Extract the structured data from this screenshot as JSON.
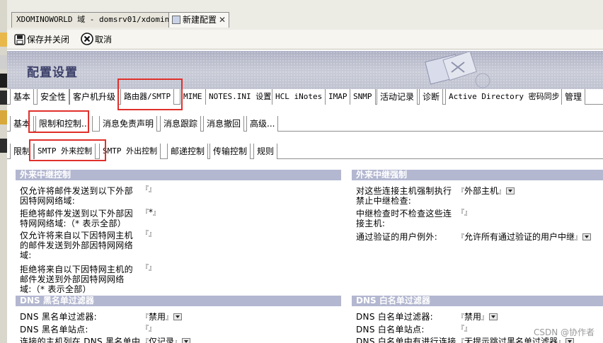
{
  "window_tabs": [
    {
      "label": "XDOMINOWORLD 域 - domsrv01/xdomino"
    },
    {
      "label": "新建配置"
    }
  ],
  "toolbar": {
    "save_close": "保存并关闭",
    "cancel": "取消"
  },
  "banner": {
    "title": "配置设置"
  },
  "main_tabs": [
    "基本",
    "安全性",
    "客户机升级",
    "路由器/SMTP",
    "MIME",
    "NOTES.INI 设置",
    "HCL iNotes",
    "IMAP",
    "SNMP",
    "活动记录",
    "诊断",
    "Active Directory 密码同步",
    "管理"
  ],
  "sub_tabs": [
    "基本",
    "限制和控制...",
    "消息免责声明",
    "消息跟踪",
    "消息撤回",
    "高级..."
  ],
  "sub_sub_tabs": [
    "限制",
    "SMTP 外来控制",
    "SMTP 外出控制",
    "邮递控制",
    "传输控制",
    "规则"
  ],
  "left_section": {
    "header": "外来中继控制",
    "rows": [
      {
        "label": "仅允许将邮件发送到以下外部因特网网络域:",
        "value": ""
      },
      {
        "label": "拒绝将邮件发送到以下外部因特网网络域:（* 表示全部）",
        "value": "*"
      },
      {
        "label": "仅允许将来自以下因特网主机的邮件发送到外部因特网网络域:",
        "value": ""
      },
      {
        "label": "拒绝将来自以下因特网主机的邮件发送到外部因特网网络域:（* 表示全部）",
        "value": ""
      }
    ]
  },
  "right_section": {
    "header": "外来中继强制",
    "rows": [
      {
        "label": "对这些连接主机强制执行禁止中继检查:",
        "value": "外部主机"
      },
      {
        "label": "中继检查时不检查这些连接主机:",
        "value": ""
      },
      {
        "label": "通过验证的用户例外:",
        "value": "允许所有通过验证的用户中继"
      }
    ]
  },
  "dns_black": {
    "header": "DNS 黑名单过滤器",
    "rows": [
      {
        "label": "DNS 黑名单过滤器:",
        "value": "禁用"
      },
      {
        "label": "DNS 黑名单站点:",
        "value": ""
      },
      {
        "label": "连接的主机列在 DNS 黑名单中",
        "value": "仅记录"
      }
    ]
  },
  "dns_white": {
    "header": "DNS 白名单过滤器",
    "rows": [
      {
        "label": "DNS 白名单过滤器:",
        "value": "禁用"
      },
      {
        "label": "DNS 白名单站点:",
        "value": ""
      },
      {
        "label": "DNS 白名单中有进行连接",
        "value": "无提示跳过黑名单过滤器"
      }
    ]
  },
  "watermark": "CSDN @协作者",
  "colors": {
    "section_header": "#b3b7d0",
    "banner_title": "#3d416a",
    "highlight_box": "#e0302b"
  }
}
